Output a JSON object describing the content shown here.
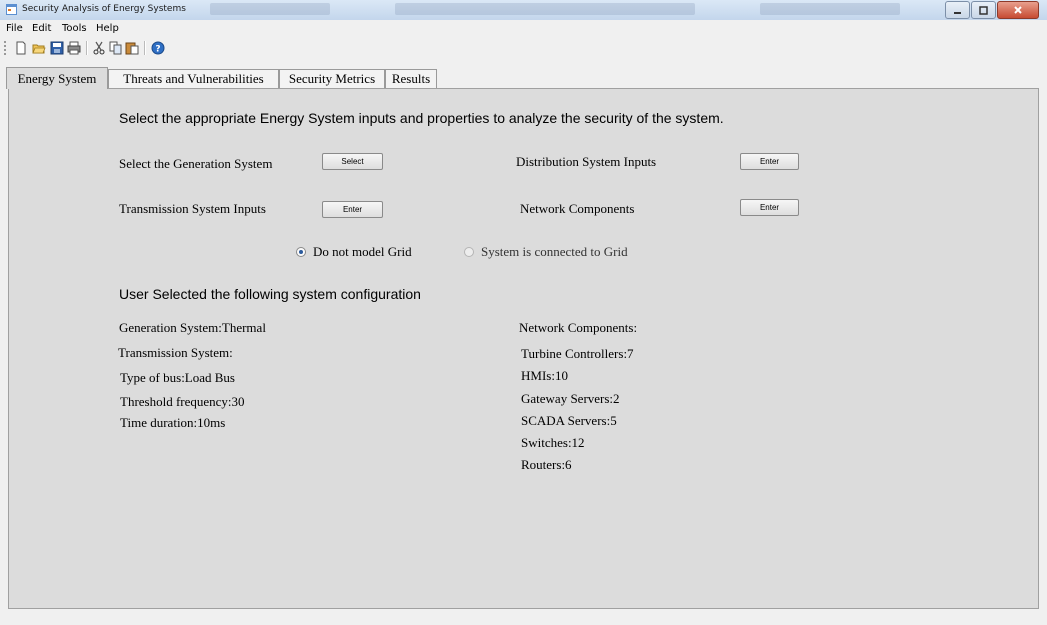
{
  "window": {
    "title": "Security Analysis of Energy Systems",
    "app_icon": "app-window-icon",
    "controls": [
      "minimize-icon",
      "maximize-icon",
      "close-icon"
    ]
  },
  "menu": {
    "items": [
      "File",
      "Edit",
      "Tools",
      "Help"
    ]
  },
  "toolbar": {
    "icons": [
      "new-file-icon",
      "open-folder-icon",
      "save-icon",
      "print-icon",
      "cut-icon",
      "copy-icon",
      "paste-icon",
      "help-icon"
    ]
  },
  "tabs": [
    {
      "label": "Energy System",
      "active": true
    },
    {
      "label": "Threats and Vulnerabilities",
      "active": false
    },
    {
      "label": "Security Metrics",
      "active": false
    },
    {
      "label": "Results",
      "active": false
    }
  ],
  "energy_system": {
    "instruction": "Select the appropriate Energy System inputs and properties to analyze the security of the system.",
    "generation": {
      "label": "Select the Generation System",
      "button": "Select"
    },
    "distribution": {
      "label": "Distribution System Inputs",
      "button": "Enter"
    },
    "transmission": {
      "label": "Transmission System Inputs",
      "button": "Enter"
    },
    "network": {
      "label": "Network Components",
      "button": "Enter"
    },
    "grid_options": [
      {
        "label": "Do not model Grid",
        "selected": true
      },
      {
        "label": "System is connected to Grid",
        "selected": false
      }
    ],
    "config_heading": "User Selected the following system configuration",
    "config_left": [
      "Generation System:Thermal",
      "Transmission System:",
      "Type of bus:Load Bus",
      "Threshold frequency:30",
      "Time duration:10ms"
    ],
    "config_right": [
      "Network Components:",
      "Turbine Controllers:7",
      "HMIs:10",
      "Gateway Servers:2",
      "SCADA Servers:5",
      "Switches:12",
      "Routers:6"
    ]
  },
  "colors": {
    "panel_bg": "#dcdcdc",
    "window_bg": "#f0f0f0",
    "radio_dot": "#2b5a9c"
  }
}
